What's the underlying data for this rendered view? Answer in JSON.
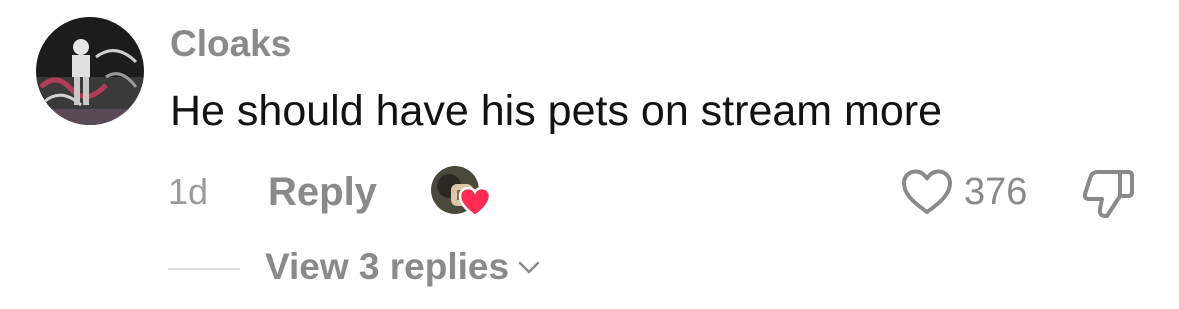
{
  "comment": {
    "username": "Cloaks",
    "text": "He should have his pets on stream more",
    "timestamp": "1d",
    "reply_label": "Reply",
    "like_count": "376",
    "view_replies_label": "View 3 replies"
  },
  "icons": {
    "avatar": "user-avatar-photo",
    "creator_like": "creator-liked-heart-icon",
    "like": "heart-outline-icon",
    "dislike": "thumbs-down-icon",
    "expand": "chevron-down-icon"
  },
  "colors": {
    "text": "#121212",
    "muted": "#8a8a8a",
    "heart": "#fe2c55"
  }
}
